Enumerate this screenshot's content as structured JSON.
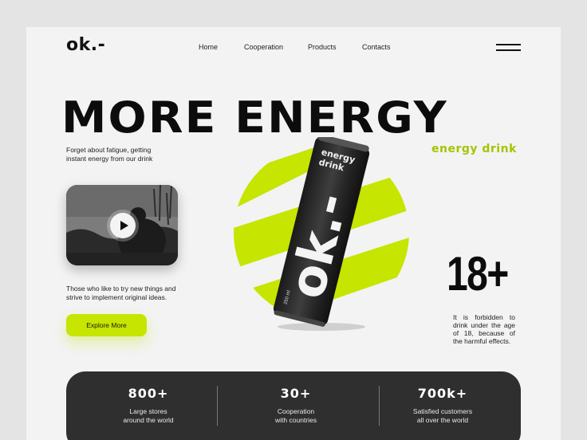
{
  "brand": {
    "logo": "ok.-"
  },
  "nav": {
    "items": [
      {
        "label": "Home"
      },
      {
        "label": "Cooperation"
      },
      {
        "label": "Products"
      },
      {
        "label": "Contacts"
      }
    ],
    "menu_icon": "hamburger-menu-icon"
  },
  "hero": {
    "title": "MORE ENERGY",
    "subtitle": "energy drink",
    "intro": "Forget about fatigue, getting instant energy from our drink",
    "tagline": "Those who like to try new things and strive to implement original ideas.",
    "cta_label": "Explore More",
    "play_icon": "play-icon"
  },
  "product": {
    "can_label_small": "energy drink",
    "can_logo": "ok.-",
    "can_volume": "250 ml"
  },
  "age": {
    "value": "18+",
    "warning": "It is forbidden to drink under the age of 18, because of the harmful effects."
  },
  "stats": [
    {
      "value": "800+",
      "label_line1": "Large stores",
      "label_line2": "around the world"
    },
    {
      "value": "30+",
      "label_line1": "Cooperation",
      "label_line2": "with countries"
    },
    {
      "value": "700k+",
      "label_line1": "Satisfied customers",
      "label_line2": "all over the world"
    }
  ],
  "colors": {
    "accent": "#c6e500",
    "dark": "#2f2f2f",
    "background": "#f3f3f3",
    "outer_background": "#e4e4e4"
  }
}
